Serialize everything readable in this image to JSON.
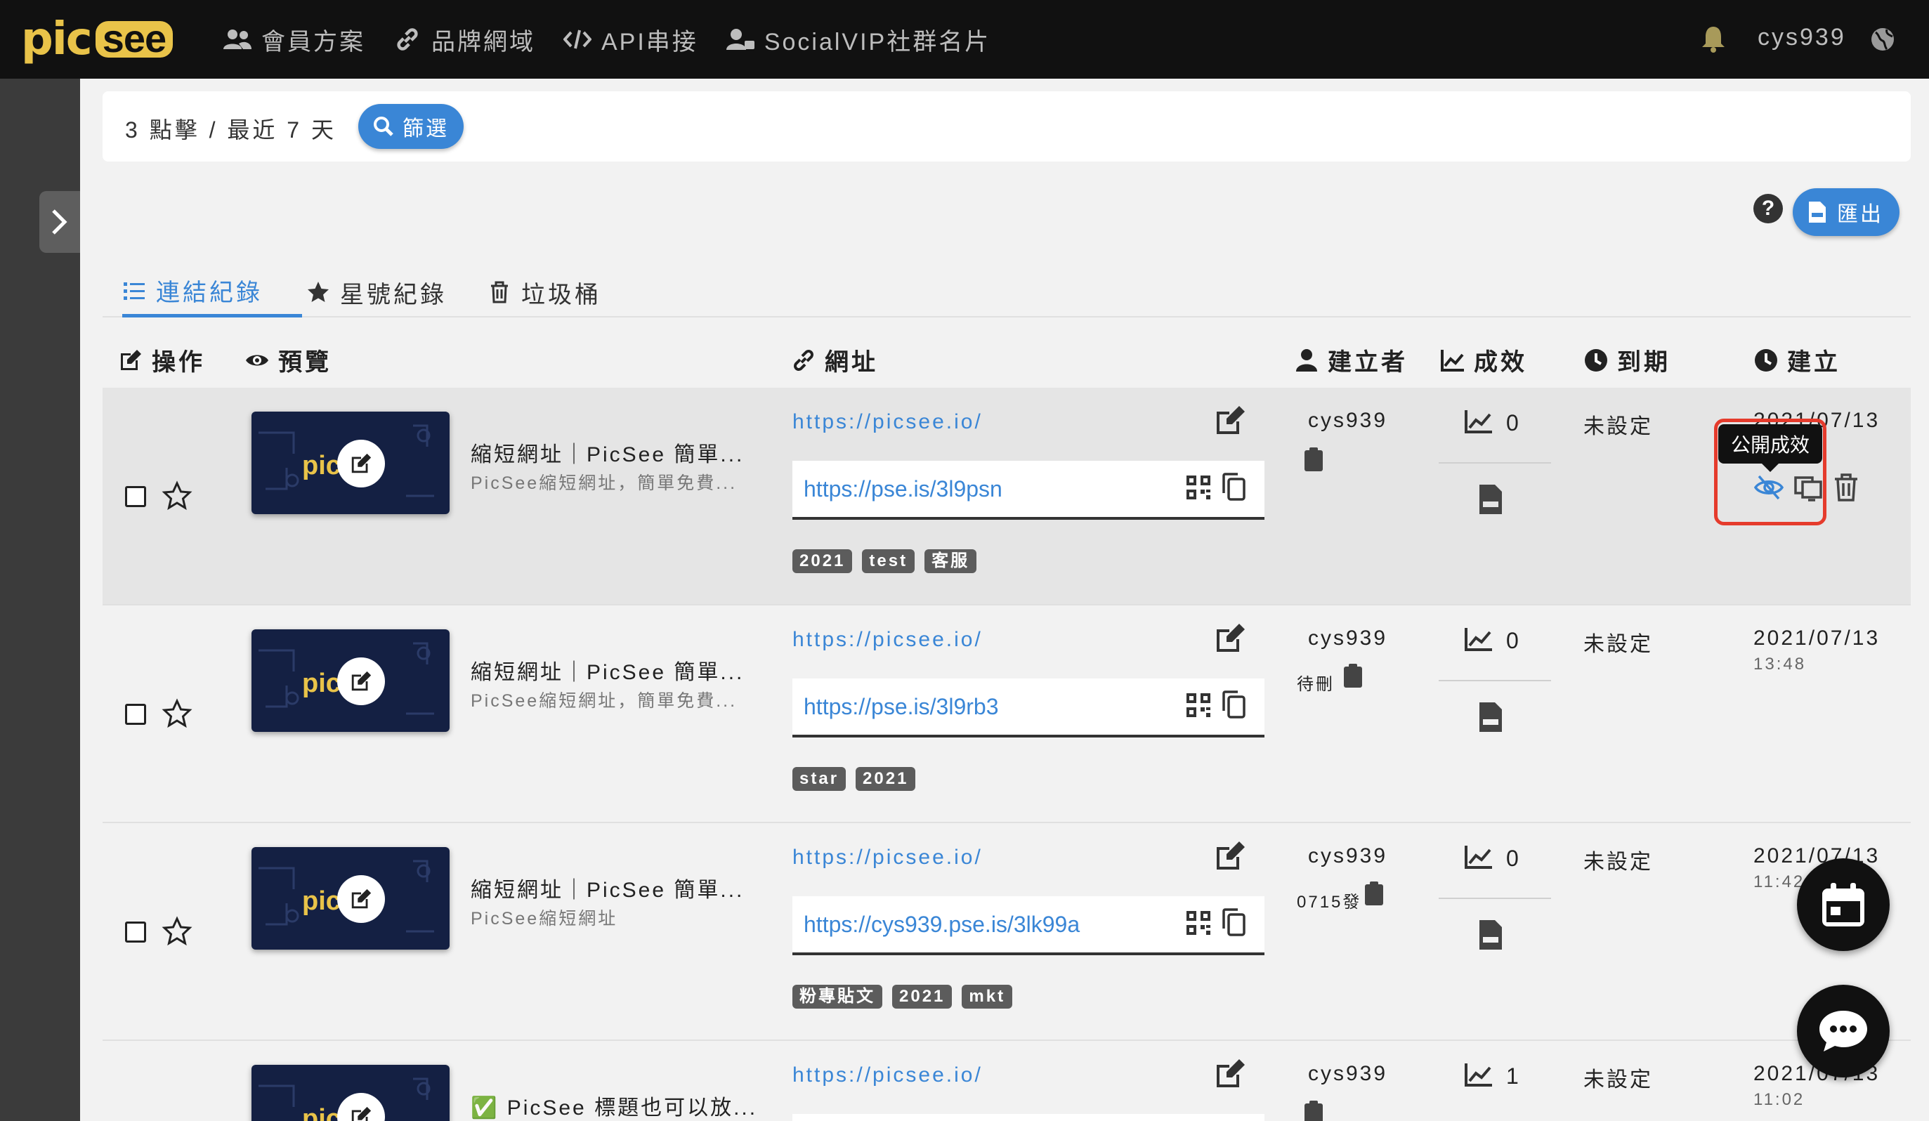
{
  "nav": {
    "logo_pic": "pic",
    "logo_see": "see",
    "items": [
      {
        "label": "會員方案",
        "icon": "users-icon"
      },
      {
        "label": "品牌網域",
        "icon": "link-icon"
      },
      {
        "label": "API串接",
        "icon": "code-icon"
      },
      {
        "label": "SocialVIP社群名片",
        "icon": "user-card-icon"
      }
    ],
    "username": "cys939"
  },
  "filter": {
    "summary": "3 點擊 / 最近 7 天",
    "button_label": "篩選"
  },
  "toolbar": {
    "help_label": "?",
    "export_label": "匯出"
  },
  "tabs": [
    {
      "label": "連結紀錄",
      "active": true
    },
    {
      "label": "星號紀錄",
      "active": false
    },
    {
      "label": "垃圾桶",
      "active": false
    }
  ],
  "columns": {
    "action": "操作",
    "preview": "預覽",
    "url": "網址",
    "creator": "建立者",
    "stats": "成效",
    "expire": "到期",
    "created": "建立"
  },
  "thumb_logo": "pic",
  "tooltip": "公開成效",
  "rows": [
    {
      "title": "縮短網址｜PicSee 簡單...",
      "desc": "PicSee縮短網址，簡單免費...",
      "orig_url": "https://picsee.io/",
      "short_url": "https://pse.is/3l9psn",
      "tags": [
        "2021",
        "test",
        "客服"
      ],
      "creator": "cys939",
      "note": "",
      "clicks": "0",
      "expire": "未設定",
      "date": "2021/07/13",
      "time": ""
    },
    {
      "title": "縮短網址｜PicSee 簡單...",
      "desc": "PicSee縮短網址，簡單免費...",
      "orig_url": "https://picsee.io/",
      "short_url": "https://pse.is/3l9rb3",
      "tags": [
        "star",
        "2021"
      ],
      "creator": "cys939",
      "note": "待刪",
      "clicks": "0",
      "expire": "未設定",
      "date": "2021/07/13",
      "time": "13:48"
    },
    {
      "title": "縮短網址｜PicSee 簡單...",
      "desc": "PicSee縮短網址",
      "orig_url": "https://picsee.io/",
      "short_url": "https://cys939.pse.is/3lk99a",
      "tags": [
        "粉專貼文",
        "2021",
        "mkt"
      ],
      "creator": "cys939",
      "note": "0715發",
      "clicks": "0",
      "expire": "未設定",
      "date": "2021/07/13",
      "time": "11:42"
    },
    {
      "title": "✅ PicSee 標題也可以放...",
      "desc": "",
      "orig_url": "https://picsee.io/",
      "short_url": "",
      "tags": [],
      "creator": "cys939",
      "note": "",
      "clicks": "1",
      "expire": "未設定",
      "date": "2021/07/13",
      "time": "11:02"
    }
  ]
}
